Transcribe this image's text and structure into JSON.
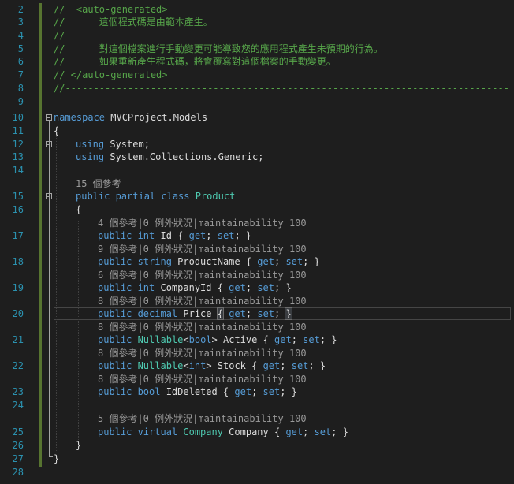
{
  "editor": {
    "lines": [
      {
        "n": "2",
        "text": "//  <auto-generated>"
      },
      {
        "n": "3",
        "text": "//      這個程式碼是由範本產生。"
      },
      {
        "n": "4",
        "text": "//"
      },
      {
        "n": "5",
        "text": "//      對這個檔案進行手動變更可能導致您的應用程式產生未預期的行為。"
      },
      {
        "n": "6",
        "text": "//      如果重新產生程式碼，將會覆寫對這個檔案的手動變更。"
      },
      {
        "n": "7",
        "text": "// </auto-generated>"
      },
      {
        "n": "8",
        "text": "//------------------------------------------------------------------------------"
      },
      {
        "n": "9",
        "text": ""
      },
      {
        "n": "10",
        "kw": "namespace",
        "rest": " MVCProject.Models"
      },
      {
        "n": "11",
        "text": "{"
      },
      {
        "n": "12",
        "kw": "using",
        "rest": " System;"
      },
      {
        "n": "13",
        "kw": "using",
        "rest": " System.Collections.Generic;"
      },
      {
        "n": "14",
        "text": ""
      },
      {
        "n": "15",
        "kw": "public partial class",
        "type": " Product"
      },
      {
        "n": "16",
        "text": "{"
      },
      {
        "n": "17",
        "kw": "public int",
        "name": " Id { ",
        "acc1": "get",
        "mid": "; ",
        "acc2": "set",
        "end": "; }"
      },
      {
        "n": "18",
        "kw": "public string",
        "name": " ProductName { ",
        "acc1": "get",
        "mid": "; ",
        "acc2": "set",
        "end": "; }"
      },
      {
        "n": "19",
        "kw": "public int",
        "name": " CompanyId { ",
        "acc1": "get",
        "mid": "; ",
        "acc2": "set",
        "end": "; }"
      },
      {
        "n": "20",
        "kw": "public decimal",
        "name": " Price ",
        "brace_open": "{",
        "pre": " ",
        "acc1": "get",
        "mid": "; ",
        "acc2": "set",
        "end": "; ",
        "brace_close": "}"
      },
      {
        "n": "21",
        "kw": "public",
        "type": " Nullable",
        "gen_open": "<",
        "gen_kw": "bool",
        "gen_close": ">",
        "name": " Active { ",
        "acc1": "get",
        "mid": "; ",
        "acc2": "set",
        "end": "; }"
      },
      {
        "n": "22",
        "kw": "public",
        "type": " Nullable",
        "gen_open": "<",
        "gen_kw": "int",
        "gen_close": ">",
        "name": " Stock { ",
        "acc1": "get",
        "mid": "; ",
        "acc2": "set",
        "end": "; }"
      },
      {
        "n": "23",
        "kw": "public bool",
        "name": " IdDeleted { ",
        "acc1": "get",
        "mid": "; ",
        "acc2": "set",
        "end": "; }"
      },
      {
        "n": "24",
        "text": ""
      },
      {
        "n": "25",
        "kw": "public virtual",
        "type": " Company",
        "name": " Company { ",
        "acc1": "get",
        "mid": "; ",
        "acc2": "set",
        "end": "; }"
      },
      {
        "n": "26",
        "text": "}"
      },
      {
        "n": "27",
        "text": "}"
      },
      {
        "n": "28",
        "text": ""
      }
    ],
    "lenses": {
      "product": "15 個參考",
      "id": "4 個參考|0 例外狀況|maintainability 100",
      "productname": "9 個參考|0 例外狀況|maintainability 100",
      "companyid": "6 個參考|0 例外狀況|maintainability 100",
      "price": "8 個參考|0 例外狀況|maintainability 100",
      "active": "8 個參考|0 例外狀況|maintainability 100",
      "stock": "8 個參考|0 例外狀況|maintainability 100",
      "iddeleted": "8 個參考|0 例外狀況|maintainability 100",
      "company": "5 個參考|0 例外狀況|maintainability 100"
    },
    "colors": {
      "background": "#1e1e1e",
      "line_number": "#2b91af",
      "keyword": "#569cd6",
      "type": "#4ec9b0",
      "comment": "#57a64a",
      "text": "#dcdcdc",
      "codelens": "#999999",
      "change_bar": "#577430"
    }
  }
}
